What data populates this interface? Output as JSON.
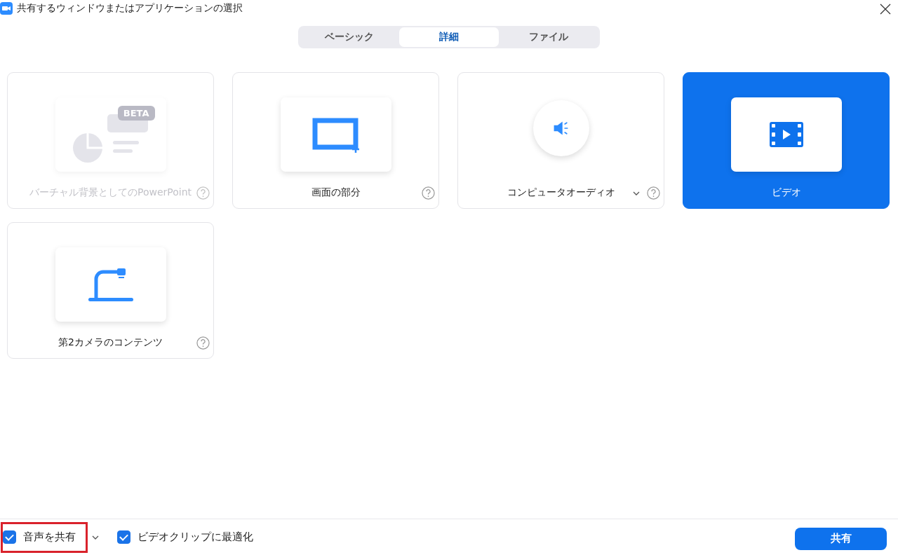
{
  "window": {
    "title": "共有するウィンドウまたはアプリケーションの選択"
  },
  "tabs": [
    {
      "label": "ベーシック",
      "selected": false
    },
    {
      "label": "詳細",
      "selected": true
    },
    {
      "label": "ファイル",
      "selected": false
    }
  ],
  "options": [
    {
      "kind": "ppt",
      "label": "バーチャル背景としてのPowerPoint",
      "badge": "BETA",
      "disabled": true,
      "selected": false,
      "help": true,
      "dropdown": false
    },
    {
      "kind": "region",
      "label": "画面の部分",
      "disabled": false,
      "selected": false,
      "help": true,
      "dropdown": false
    },
    {
      "kind": "audio",
      "label": "コンピュータオーディオ",
      "disabled": false,
      "selected": false,
      "help": true,
      "dropdown": true
    },
    {
      "kind": "video",
      "label": "ビデオ",
      "disabled": false,
      "selected": true,
      "help": false,
      "dropdown": false
    },
    {
      "kind": "camera",
      "label": "第2カメラのコンテンツ",
      "disabled": false,
      "selected": false,
      "help": true,
      "dropdown": false
    }
  ],
  "footer": {
    "checkboxes": [
      {
        "label": "音声を共有",
        "checked": true,
        "highlighted": true,
        "dropdown": true
      },
      {
        "label": "ビデオクリップに最適化",
        "checked": true,
        "highlighted": false,
        "dropdown": false
      }
    ],
    "share_button": "共有"
  }
}
